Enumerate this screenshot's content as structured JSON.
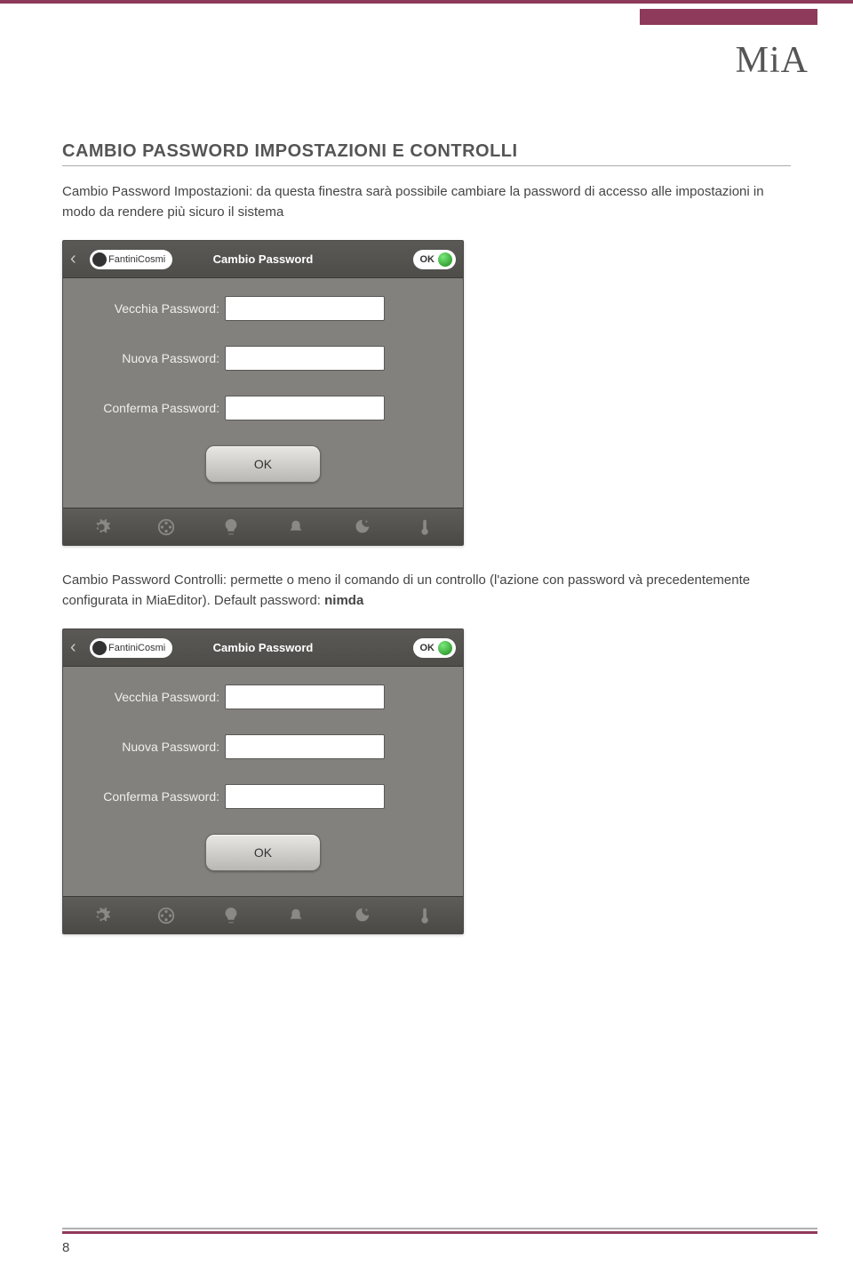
{
  "page": {
    "logo": "MiA",
    "section_title": "CAMBIO PASSWORD IMPOSTAZIONI E CONTROLLI",
    "paragraph1": "Cambio Password Impostazioni: da questa finestra sarà possibile cambiare la password di accesso alle impostazioni in modo da rendere più sicuro il sistema",
    "paragraph2_a": "Cambio Password Controlli: permette o meno il comando di un controllo (l'azione con password và precedentemente configurata in MiaEditor). Default password: ",
    "paragraph2_b": "nimda",
    "page_number": "8"
  },
  "app": {
    "brand": "FantiniCosmi",
    "header_title": "Cambio Password",
    "ok_label": "OK",
    "fields": {
      "old": "Vecchia Password:",
      "new": "Nuova Password:",
      "confirm": "Conferma Password:"
    },
    "submit": "OK"
  }
}
